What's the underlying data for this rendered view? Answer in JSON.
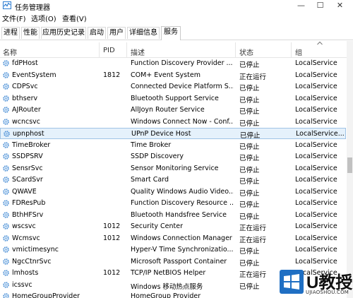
{
  "window": {
    "title": "任务管理器"
  },
  "menu": [
    "文件(F)",
    "选项(O)",
    "查看(V)"
  ],
  "tabs": [
    "进程",
    "性能",
    "应用历史记录",
    "启动",
    "用户",
    "详细信息",
    "服务"
  ],
  "active_tab": "服务",
  "columns": {
    "name": "名称",
    "pid": "PID",
    "desc": "描述",
    "status": "状态",
    "group": "组"
  },
  "rows": [
    {
      "name": "fdPHost",
      "pid": "",
      "desc": "Function Discovery Provider ...",
      "status": "已停止",
      "group": "LocalService"
    },
    {
      "name": "EventSystem",
      "pid": "1812",
      "desc": "COM+ Event System",
      "status": "正在运行",
      "group": "LocalService"
    },
    {
      "name": "CDPSvc",
      "pid": "",
      "desc": "Connected Device Platform S...",
      "status": "已停止",
      "group": "LocalService"
    },
    {
      "name": "bthserv",
      "pid": "",
      "desc": "Bluetooth Support Service",
      "status": "已停止",
      "group": "LocalService"
    },
    {
      "name": "AJRouter",
      "pid": "",
      "desc": "AllJoyn Router Service",
      "status": "已停止",
      "group": "LocalService"
    },
    {
      "name": "wcncsvc",
      "pid": "",
      "desc": "Windows Connect Now - Conf...",
      "status": "已停止",
      "group": "LocalService"
    },
    {
      "name": "upnphost",
      "pid": "",
      "desc": "UPnP Device Host",
      "status": "已停止",
      "group": "LocalService..."
    },
    {
      "name": "TimeBroker",
      "pid": "",
      "desc": "Time Broker",
      "status": "已停止",
      "group": "LocalService"
    },
    {
      "name": "SSDPSRV",
      "pid": "",
      "desc": "SSDP Discovery",
      "status": "已停止",
      "group": "LocalService"
    },
    {
      "name": "SensrSvc",
      "pid": "",
      "desc": "Sensor Monitoring Service",
      "status": "已停止",
      "group": "LocalService"
    },
    {
      "name": "SCardSvr",
      "pid": "",
      "desc": "Smart Card",
      "status": "已停止",
      "group": "LocalService"
    },
    {
      "name": "QWAVE",
      "pid": "",
      "desc": "Quality Windows Audio Video...",
      "status": "已停止",
      "group": "LocalService"
    },
    {
      "name": "FDResPub",
      "pid": "",
      "desc": "Function Discovery Resource ...",
      "status": "已停止",
      "group": "LocalService"
    },
    {
      "name": "BthHFSrv",
      "pid": "",
      "desc": "Bluetooth Handsfree Service",
      "status": "已停止",
      "group": "LocalService"
    },
    {
      "name": "wscsvc",
      "pid": "1012",
      "desc": "Security Center",
      "status": "正在运行",
      "group": "LocalService"
    },
    {
      "name": "Wcmsvc",
      "pid": "1012",
      "desc": "Windows Connection Manager",
      "status": "正在运行",
      "group": "LocalService"
    },
    {
      "name": "vmictimesync",
      "pid": "",
      "desc": "Hyper-V Time Synchronizatio...",
      "status": "已停止",
      "group": "LocalService"
    },
    {
      "name": "NgcCtnrSvc",
      "pid": "",
      "desc": "Microsoft Passport Container",
      "status": "已停止",
      "group": "LocalService"
    },
    {
      "name": "lmhosts",
      "pid": "1012",
      "desc": "TCP/IP NetBIOS Helper",
      "status": "正在运行",
      "group": "LocalService"
    },
    {
      "name": "icssvc",
      "pid": "",
      "desc": "Windows 移动热点服务",
      "status": "已停止",
      "group": ""
    },
    {
      "name": "HomeGroupProvider",
      "pid": "",
      "desc": "HomeGroup Provider",
      "status": "",
      "group": ""
    }
  ],
  "selected_row": "upnphost",
  "watermark": {
    "brand": "U教授",
    "url": "UJIAOSHOU.COM"
  },
  "colors": {
    "selected_bg": "#e5f1fb",
    "selected_border": "#9fc3e6",
    "watermark_blue": "#1f6fc3"
  }
}
